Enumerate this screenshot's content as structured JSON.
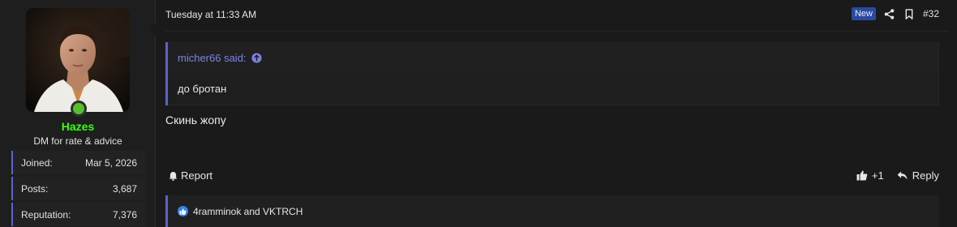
{
  "user": {
    "name": "Hazes",
    "title": "DM for rate & advice",
    "name_color": "#39ff14",
    "online_color": "#55c02b",
    "stats": [
      {
        "label": "Joined:",
        "value": "Mar 5, 2026"
      },
      {
        "label": "Posts:",
        "value": "3,687"
      },
      {
        "label": "Reputation:",
        "value": "7,376"
      }
    ]
  },
  "post": {
    "date": "Tuesday at 11:33 AM",
    "badge": "New",
    "number": "#32",
    "quote": {
      "author": "micher66 said:",
      "text": "до бротан"
    },
    "message": "Скинь жопу",
    "actions": {
      "report": "Report",
      "like_count": "+1",
      "reply": "Reply"
    },
    "reactions_text": "4ramminok and VKTRCH"
  },
  "icons": {
    "share": "share-icon",
    "bookmark": "bookmark-icon",
    "quote_arrow": "arrow-up-circle-icon",
    "report": "bell-icon",
    "like": "thumbs-up-icon",
    "reply": "reply-icon",
    "reaction": "like-reaction-icon"
  },
  "colors": {
    "accent": "#5b64c9",
    "quote_author": "#7b84e4",
    "badge_bg": "#2a4aa0",
    "reaction_bubble": "#2f86e8"
  }
}
